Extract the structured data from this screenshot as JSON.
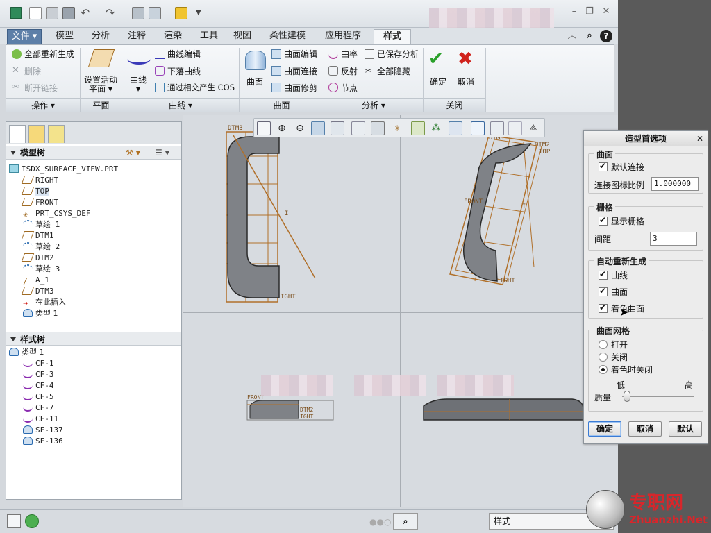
{
  "ribbon_tabs": [
    "文件",
    "模型",
    "分析",
    "注释",
    "渲染",
    "工具",
    "视图",
    "柔性建模",
    "应用程序",
    "样式"
  ],
  "ribbon": {
    "operations": {
      "regen_all": "全部重新生成",
      "delete": "删除",
      "break_link": "断开链接",
      "group": "操作"
    },
    "plane": {
      "set_active_plane_1": "设置活动",
      "set_active_plane_2": "平面",
      "group": "平面"
    },
    "curve": {
      "curve": "曲线",
      "curve_edit": "曲线编辑",
      "drop_curve": "下落曲线",
      "cos": "通过相交产生 COS",
      "group": "曲线"
    },
    "surface": {
      "surface": "曲面",
      "surface_edit": "曲面编辑",
      "surface_connect": "曲面连接",
      "surface_trim": "曲面修剪",
      "group": "曲面"
    },
    "analysis": {
      "curvature": "曲率",
      "saved_analysis": "已保存分析",
      "reflection": "反射",
      "hide_all": "全部隐藏",
      "node": "节点",
      "group": "分析"
    },
    "close": {
      "ok": "确定",
      "cancel": "取消",
      "group": "关闭"
    }
  },
  "model_tree": {
    "header": "模型树",
    "root": "ISDX_SURFACE_VIEW.PRT",
    "items": [
      "RIGHT",
      "TOP",
      "FRONT",
      "PRT_CSYS_DEF",
      "草绘 1",
      "DTM1",
      "草绘 2",
      "DTM2",
      "草绘 3",
      "A_1",
      "DTM3",
      "在此插入",
      "类型 1"
    ]
  },
  "style_tree": {
    "header": "样式树",
    "root": "类型 1",
    "items": [
      "CF-1",
      "CF-3",
      "CF-4",
      "CF-5",
      "CF-7",
      "CF-11",
      "SF-137",
      "SF-136"
    ]
  },
  "viewport_labels": {
    "dtm3": "DTM3",
    "i1": "I",
    "ight": "IGHT",
    "dtm2": "DTM2",
    "top": "TOP",
    "front": "FRONT",
    "dtm3b": "DTM3",
    "ight2": "IGHT",
    "i2": "I",
    "dtm2b": "DTM2",
    "ight3": "IGHT",
    "front2": "FRONT"
  },
  "status_bar": {
    "filter": "样式"
  },
  "dialog": {
    "title": "造型首选项",
    "surface_section": "曲面",
    "default_connect": "默认连接",
    "connect_icon_scale_label": "连接图标比例",
    "connect_icon_scale_value": "1.000000",
    "grid_section": "栅格",
    "show_grid": "显示栅格",
    "spacing_label": "间距",
    "spacing_value": "3",
    "auto_regen_section": "自动重新生成",
    "curves": "曲线",
    "surfaces": "曲面",
    "shaded_surfaces": "着色曲面",
    "mesh_section": "曲面网格",
    "mesh_on": "打开",
    "mesh_off": "关闭",
    "mesh_off_when_shaded": "着色时关闭",
    "quality_low": "低",
    "quality_high": "高",
    "quality_label": "质量",
    "ok": "确定",
    "cancel": "取消",
    "default": "默认"
  },
  "watermark": {
    "cn": "专职网",
    "url": "Zhuanzhi.Net"
  }
}
